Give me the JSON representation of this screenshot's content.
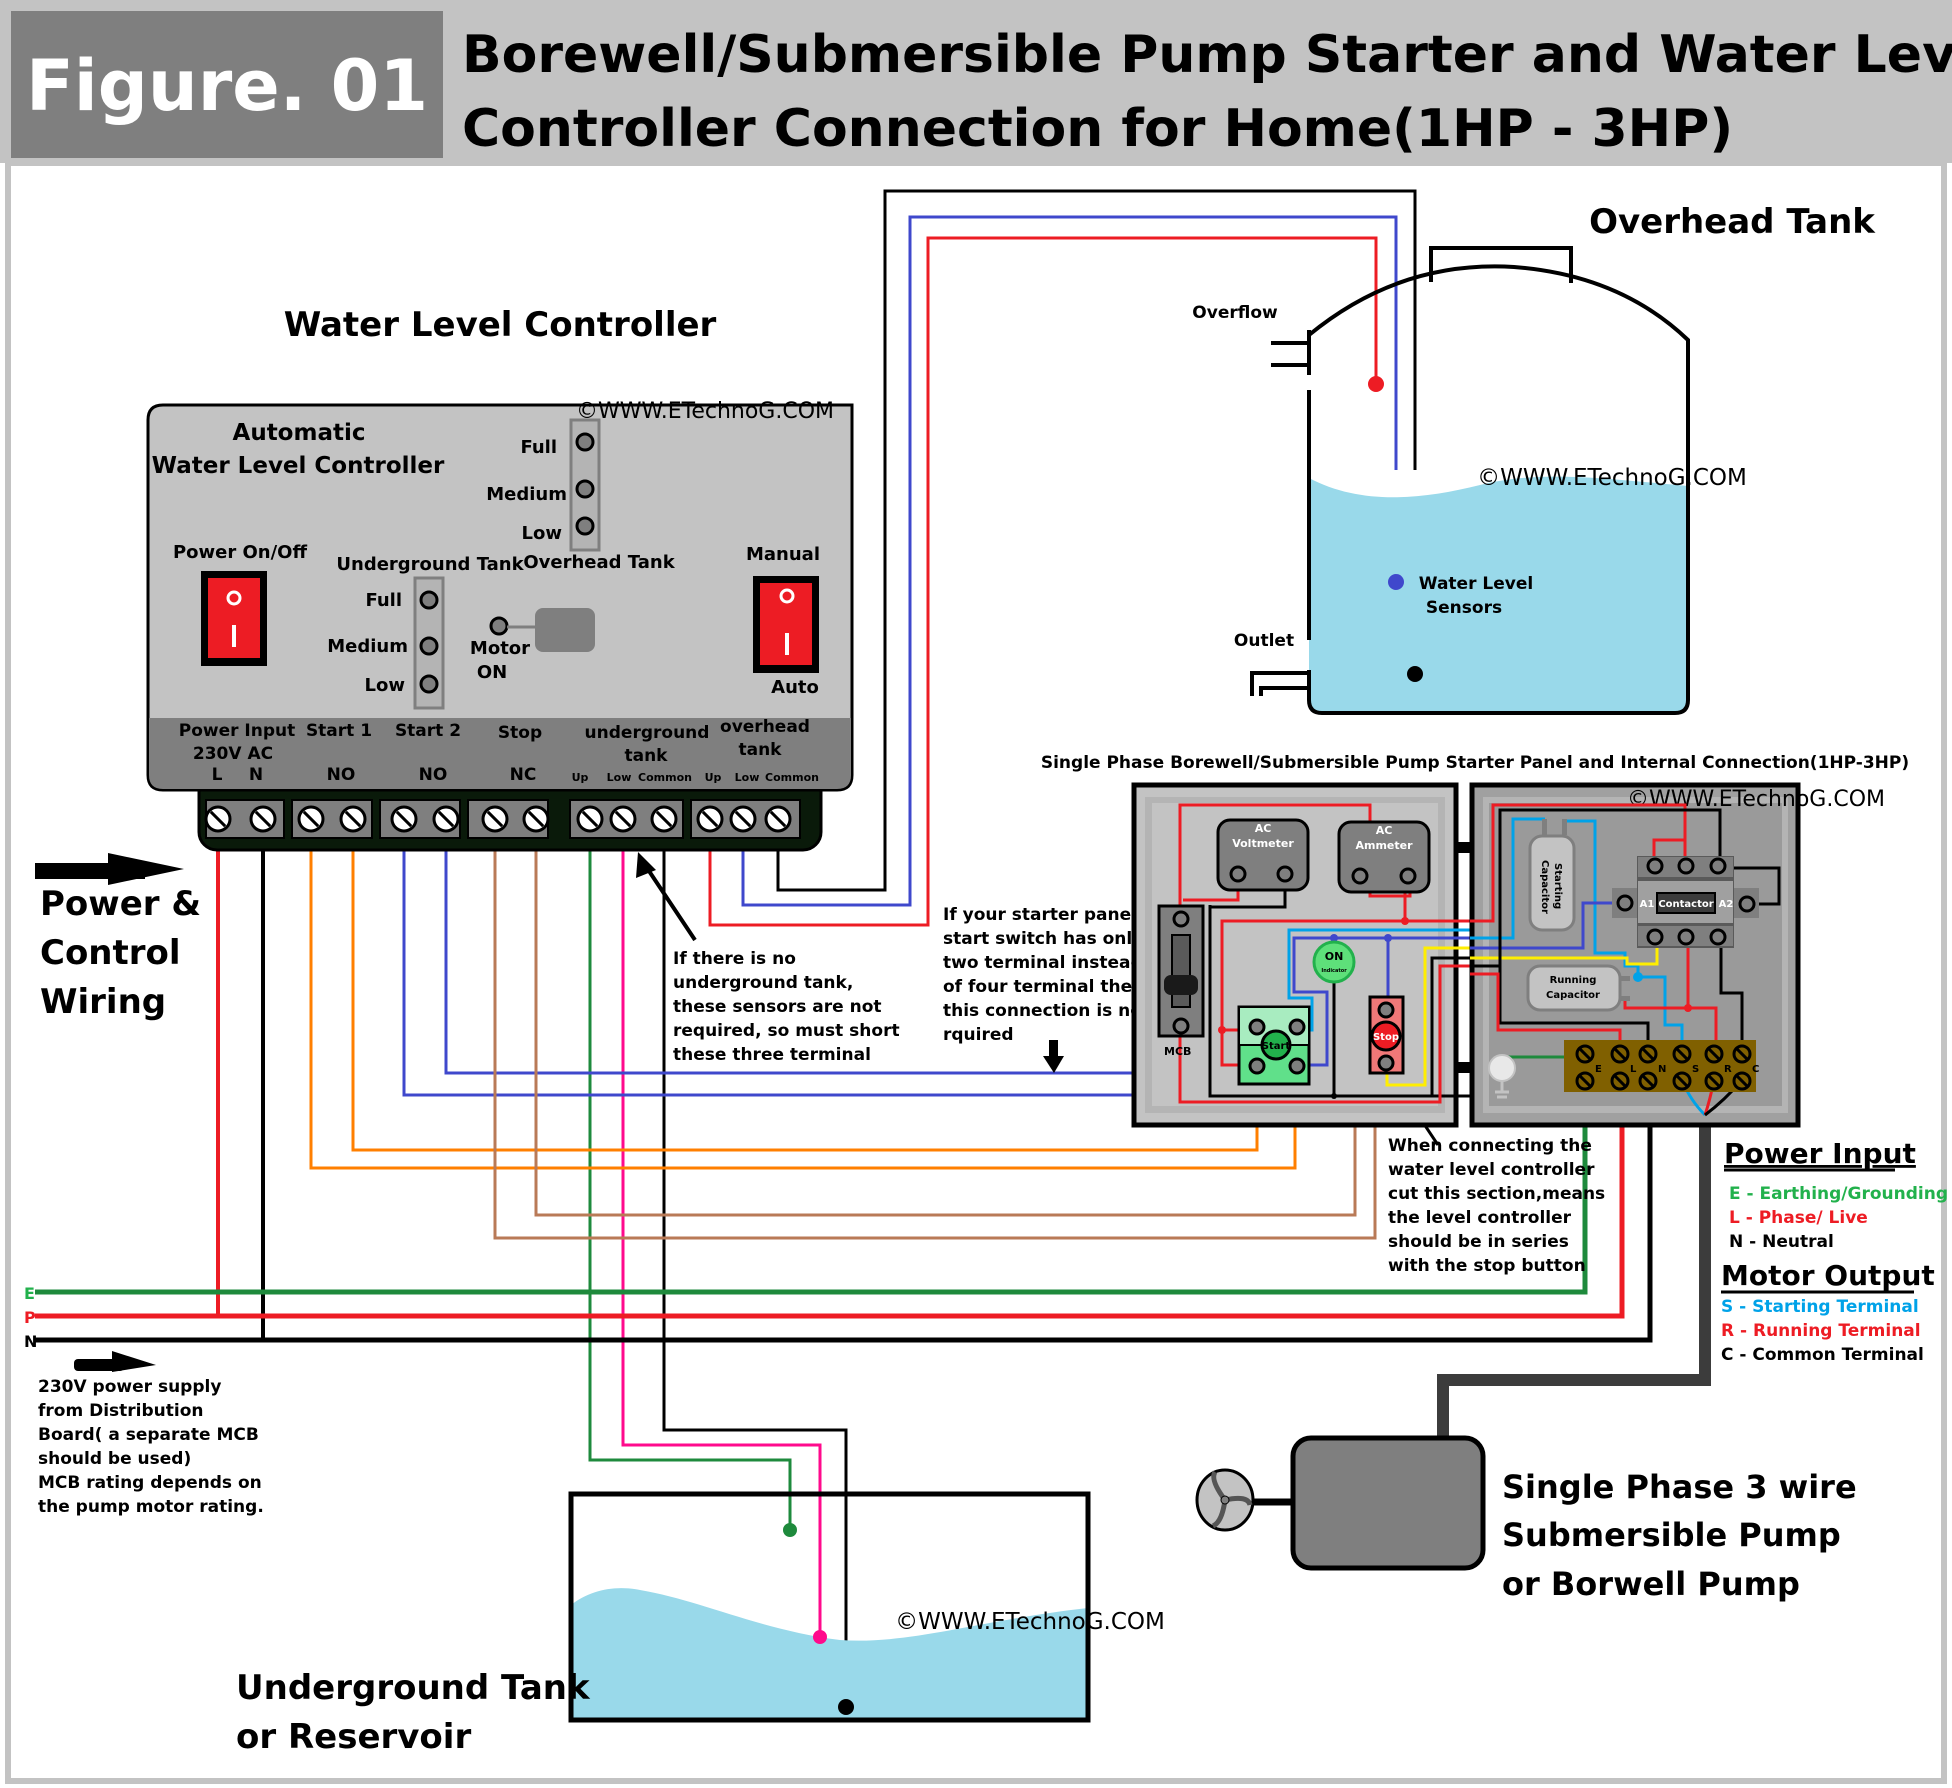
{
  "header": {
    "figure_label": "Figure. 01",
    "title_line1": "Borewell/Submersible Pump Starter and Water Level",
    "title_line2": "Controller Connection for Home(1HP - 3HP)"
  },
  "watermark": "©WWW.ETechnoG.COM",
  "controller": {
    "section_title": "Water Level Controller",
    "device_title_line1": "Automatic",
    "device_title_line2": "Water Level Controller",
    "power_switch_label": "Power On/Off",
    "mode_switch_top_label": "Manual",
    "mode_switch_bottom_label": "Auto",
    "switch_off_symbol": "O",
    "switch_on_symbol": "I",
    "overhead_tank_label": "Overhead Tank",
    "underground_tank_label": "Underground Tank",
    "level_labels": [
      "Full",
      "Medium",
      "Low"
    ],
    "motor_on_line1": "Motor",
    "motor_on_line2": "ON",
    "terminal_groups": [
      {
        "name_line1": "Power Input",
        "name_line2": "230V AC",
        "sub": [
          "L",
          "N"
        ]
      },
      {
        "name_line1": "Start 1",
        "name_line2": "",
        "sub": [
          "NO"
        ]
      },
      {
        "name_line1": "Start 2",
        "name_line2": "",
        "sub": [
          "NO"
        ]
      },
      {
        "name_line1": "Stop",
        "name_line2": "",
        "sub": [
          "NC"
        ]
      },
      {
        "name_line1": "underground",
        "name_line2": "tank",
        "sub": [
          "Up",
          "Low",
          "Common"
        ]
      },
      {
        "name_line1": "overhead",
        "name_line2": "tank",
        "sub": [
          "Up",
          "Low",
          "Common"
        ]
      }
    ]
  },
  "left_notes": {
    "power_control_line1": "Power &",
    "power_control_line2": "Control",
    "power_control_line3": "Wiring",
    "supply_lines": [
      "E",
      "P",
      "N"
    ],
    "supply_colors": {
      "E": "#1e8a3c",
      "P": "#ed1c24",
      "N": "#000000"
    },
    "supply_note": [
      "230V power supply",
      "from Distribution",
      "Board( a separate MCB",
      "should be used)",
      "MCB rating depends on",
      "the pump motor rating."
    ]
  },
  "annotations": {
    "no_underground_tank": [
      "If there is no",
      "underground tank,",
      "these sensors are not",
      "required, so must short",
      "these three terminal"
    ],
    "two_terminal_switch": [
      "If your starter panel",
      "start switch has only",
      "two terminal instead",
      "of four terminal then",
      "this connection is not",
      "rquired"
    ],
    "cut_section": [
      "When connecting the",
      "water level controller",
      "cut this section,means",
      "the level controller",
      "should be in series",
      "with the stop button"
    ]
  },
  "overhead_tank": {
    "title": "Overhead Tank",
    "overflow_label": "Overflow",
    "outlet_label": "Outlet",
    "sensor_label_line1": "Water Level",
    "sensor_label_line2": "Sensors"
  },
  "starter_panel": {
    "title": "Single Phase Borewell/Submersible Pump Starter Panel and Internal Connection(1HP-3HP)",
    "voltmeter_line1": "AC",
    "voltmeter_line2": "Voltmeter",
    "ammeter_line1": "AC",
    "ammeter_line2": "Ammeter",
    "mcb_label": "MCB",
    "on_indicator_line1": "ON",
    "on_indicator_line2": "Indicator",
    "start_label": "Start",
    "stop_label": "Stop",
    "starting_capacitor_line1": "Starting",
    "starting_capacitor_line2": "Capacitor",
    "running_capacitor_line1": "Running",
    "running_capacitor_line2": "Capacitor",
    "contactor_label": "Contactor",
    "contactor_a1": "A1",
    "contactor_a2": "A2",
    "terminal_labels": [
      "E",
      "L",
      "N",
      "S",
      "R",
      "C"
    ]
  },
  "legend": {
    "power_input_title": "Power Input",
    "power_items": [
      {
        "text": "E - Earthing/Grounding",
        "color": "#22b14c"
      },
      {
        "text": "L - Phase/ Live",
        "color": "#ed1c24"
      },
      {
        "text": "N - Neutral",
        "color": "#000000"
      }
    ],
    "motor_output_title": "Motor Output",
    "motor_items": [
      {
        "text": "S - Starting Terminal",
        "color": "#00a2e8"
      },
      {
        "text": "R - Running Terminal",
        "color": "#ed1c24"
      },
      {
        "text": "C - Common Terminal",
        "color": "#000000"
      }
    ]
  },
  "pump": {
    "label_line1": "Single Phase 3 wire",
    "label_line2": "Submersible Pump",
    "label_line3": "or Borwell Pump"
  },
  "underground_tank": {
    "label_line1": "Underground Tank",
    "label_line2": "or Reservoir"
  },
  "colors": {
    "red": "#ed1c24",
    "black": "#000000",
    "blue": "#3f48cc",
    "light_blue": "#00a2e8",
    "orange": "#ff7f00",
    "brown": "#b97a57",
    "green": "#1e8a3c",
    "pink": "#ff0a8c",
    "yellow": "#ffee00",
    "water": "#99d9ea",
    "header_dark": "#7f7f7f",
    "header_light": "#c3c3c3"
  }
}
